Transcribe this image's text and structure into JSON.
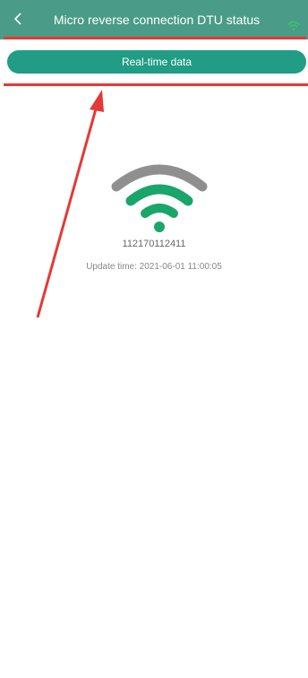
{
  "header": {
    "title": "Micro reverse connection DTU status",
    "back_icon": "chevron-left-icon",
    "status_icon": "wifi-icon"
  },
  "toolbar": {
    "realtime_label": "Real-time data"
  },
  "status": {
    "device_id": "112170112411",
    "update_label": "Update time",
    "update_separator": ": ",
    "update_value": "2021-06-01 11:00:05",
    "icon": "wifi-signal-icon"
  },
  "colors": {
    "header_bg": "#4a9b87",
    "button_bg": "#219c85",
    "wifi_green": "#1aa56a",
    "wifi_gray": "#8f8f8f",
    "annotation_red": "#e53935"
  }
}
